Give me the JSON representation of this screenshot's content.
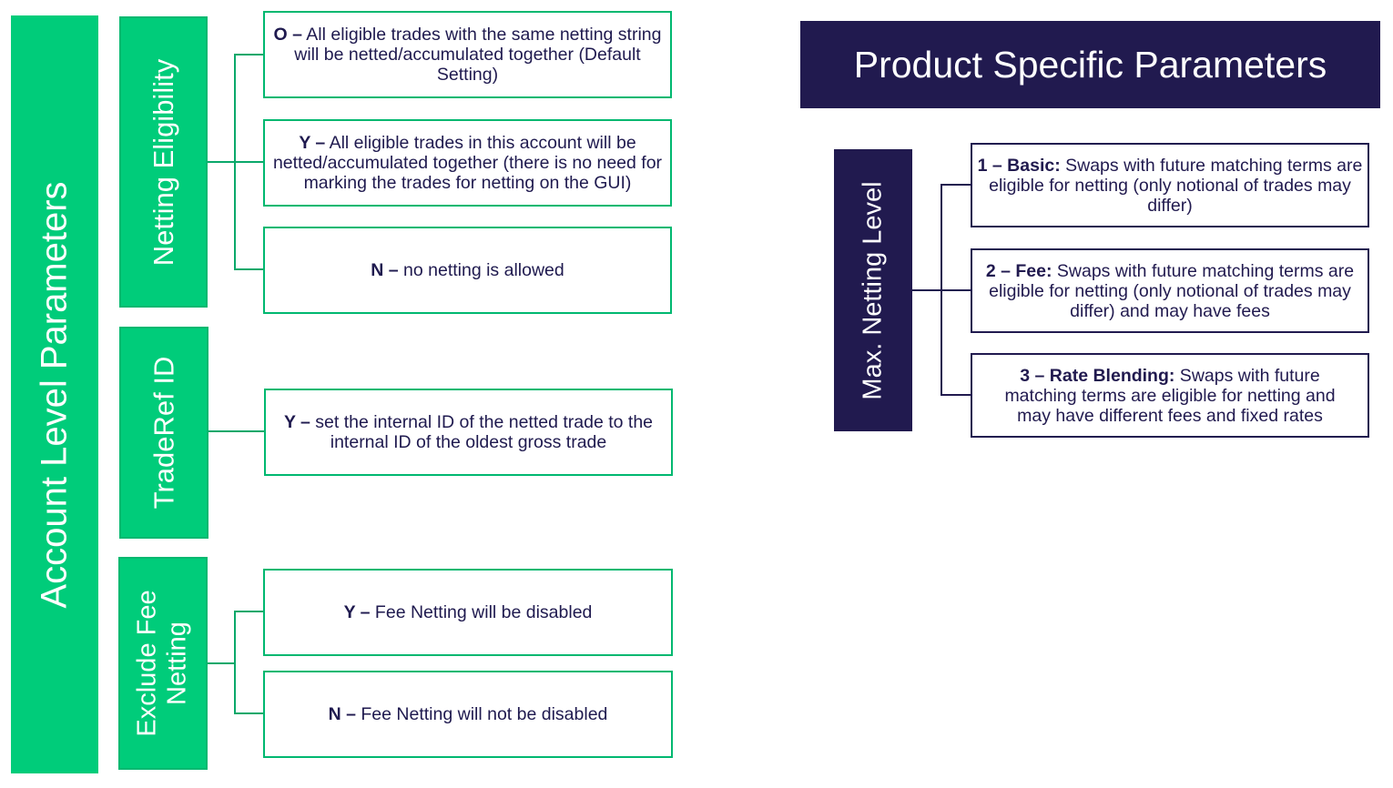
{
  "account_level": {
    "title": "Account Level Parameters",
    "groups": [
      {
        "label": "Netting Eligibility",
        "options": [
          {
            "key": "O –",
            "text": " All eligible trades with the same netting string will be netted/accumulated together (Default Setting)"
          },
          {
            "key": "Y –",
            "text": " All eligible trades in this account will be netted/accumulated together (there is no need for marking the trades for netting on the GUI)"
          },
          {
            "key": "N –",
            "text": " no netting is allowed"
          }
        ]
      },
      {
        "label": "TradeRef ID",
        "options": [
          {
            "key": "Y –",
            "text": " set the internal ID of the netted trade to the internal ID of the oldest gross trade"
          }
        ]
      },
      {
        "label_line1": "Exclude Fee",
        "label_line2": "Netting",
        "options": [
          {
            "key": "Y –",
            "text": " Fee Netting will be disabled"
          },
          {
            "key": "N –",
            "text": " Fee Netting will not be disabled"
          }
        ]
      }
    ]
  },
  "product_specific": {
    "title": "Product Specific Parameters",
    "group": {
      "label": "Max. Netting Level",
      "options": [
        {
          "key": "1 – Basic:",
          "text": " Swaps with future matching terms are eligible for netting (only notional of trades may differ)"
        },
        {
          "key": "2 – Fee:",
          "text": " Swaps with future matching terms are eligible for netting (only notional of trades may differ) and may have fees"
        },
        {
          "key": "3 – Rate Blending:",
          "text": " Swaps with future matching terms are eligible for netting and may have different fees and fixed rates"
        }
      ]
    }
  },
  "colors": {
    "account_green": "#00cc7a",
    "product_navy": "#211a4f",
    "text_navy": "#1f1a4f"
  }
}
